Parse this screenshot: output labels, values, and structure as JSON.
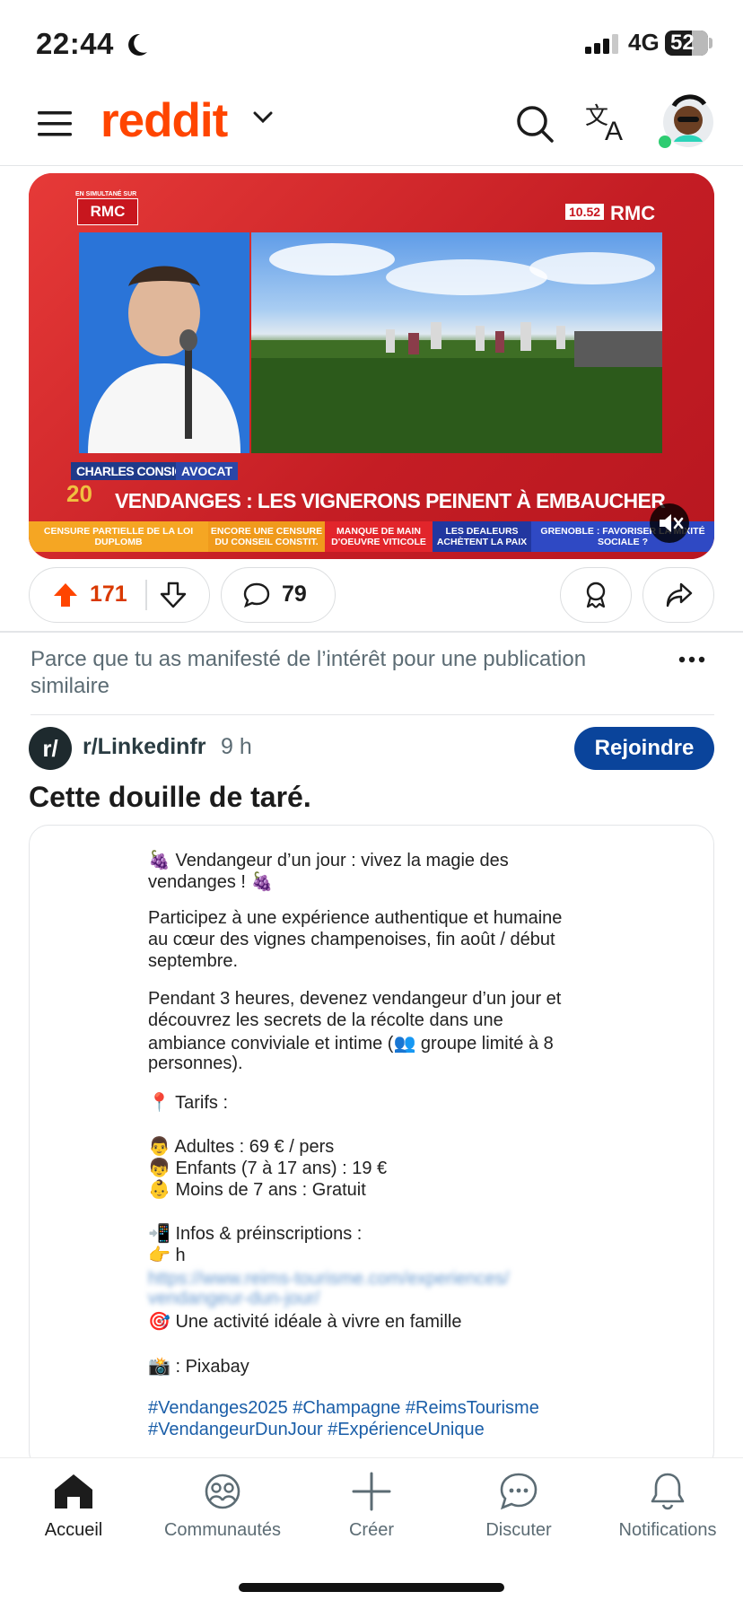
{
  "status_bar": {
    "time": "22:44",
    "network": "4G",
    "battery": "52"
  },
  "header": {
    "logo": "reddit"
  },
  "video": {
    "channel_small": "EN SIMULTANÉ SUR",
    "channel_logo": "RMC",
    "channel_right": "RMC",
    "channel_time": "10.52",
    "lower_third_name": "CHARLES CONSIGNY",
    "lower_third_role": "AVOCAT",
    "anniversary": "20",
    "headline": "VENDANGES : LES VIGNERONS PEINENT À EMBAUCHER",
    "ticker": [
      "CENSURE PARTIELLE DE LA LOI DUPLOMB",
      "ENCORE UNE CENSURE DU CONSEIL CONSTIT.",
      "MANQUE DE MAIN D'OEUVRE VITICOLE",
      "LES DEALEURS ACHÈTENT LA PAIX",
      "GRENOBLE : FAVORISER LA MIXITÉ SOCIALE ?"
    ]
  },
  "actions": {
    "votes": "171",
    "comments": "79"
  },
  "suggestion": {
    "text": "Parce que tu as manifesté de l’intérêt pour une publication similaire"
  },
  "post": {
    "subreddit": "r/Linkedinfr",
    "subreddit_avatar": "r/",
    "time": "9 h",
    "join_label": "Rejoindre",
    "title": "Cette douille de taré.",
    "image_text": {
      "l1": "🍇 Vendangeur d’un jour : vivez la magie des",
      "l2": "vendanges ! 🍇",
      "l3": "Participez à une expérience authentique et humaine",
      "l4": "au cœur des vignes champenoises, fin août / début",
      "l5": "septembre.",
      "l6": "Pendant 3 heures, devenez vendangeur d’un jour et",
      "l7": "découvrez les secrets de la récolte dans une",
      "l8": "ambiance conviviale et intime (👥 groupe limité à 8",
      "l9": "personnes).",
      "l10": "📍 Tarifs :",
      "l11": "👨 Adultes : 69 € / pers",
      "l12": "👦 Enfants (7 à 17 ans) : 19 €",
      "l13": "👶 Moins de 7 ans : Gratuit",
      "l14": "📲 Infos & préinscriptions :",
      "l15": "👉 h",
      "l16": "🎯 Une activité idéale à vivre en famille",
      "l17": "📸 : Pixabay",
      "l18": "#Vendanges2025 #Champagne #ReimsTourisme",
      "l19": "#VendangeurDunJour #ExpérienceUnique"
    }
  },
  "nav": [
    {
      "label": "Accueil",
      "icon": "home-icon"
    },
    {
      "label": "Communautés",
      "icon": "communities-icon"
    },
    {
      "label": "Créer",
      "icon": "plus-icon"
    },
    {
      "label": "Discuter",
      "icon": "chat-icon"
    },
    {
      "label": "Notifications",
      "icon": "bell-icon"
    }
  ]
}
